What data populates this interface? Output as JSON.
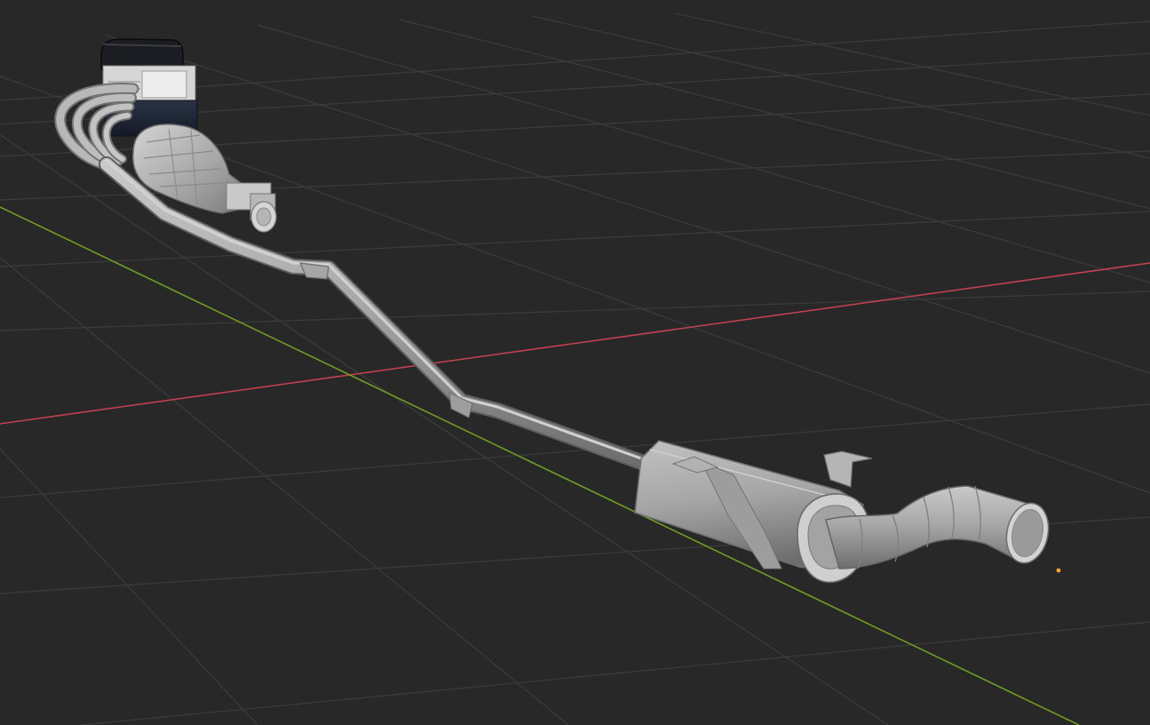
{
  "viewport": {
    "view_mode": "3D Viewport",
    "background_color": "#282828",
    "grid_color": "#4a4a4a",
    "x_axis_color": "#c4424f",
    "y_axis_color": "#6f9c22",
    "origin_color": "#ffa033"
  },
  "scene": {
    "objects": [
      {
        "name": "engine-block",
        "material": "dark-blue-gray"
      },
      {
        "name": "exhaust-manifold",
        "material": "matte-gray"
      },
      {
        "name": "transmission",
        "material": "matte-gray"
      },
      {
        "name": "exhaust-pipe",
        "material": "matte-gray"
      },
      {
        "name": "muffler",
        "material": "matte-gray"
      },
      {
        "name": "tailpipe",
        "material": "matte-gray"
      }
    ]
  }
}
